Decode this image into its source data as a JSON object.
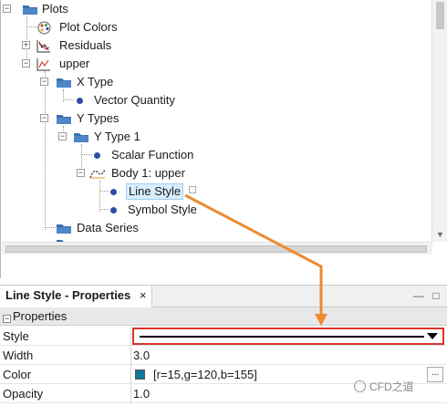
{
  "tree": {
    "items": [
      {
        "label": "Plots"
      },
      {
        "label": "Plot Colors"
      },
      {
        "label": "Residuals"
      },
      {
        "label": "upper"
      },
      {
        "label": "X Type"
      },
      {
        "label": "Vector Quantity"
      },
      {
        "label": "Y Types"
      },
      {
        "label": "Y Type 1"
      },
      {
        "label": "Scalar Function"
      },
      {
        "label": "Body 1: upper"
      },
      {
        "label": "Line Style"
      },
      {
        "label": "Symbol Style"
      },
      {
        "label": "Data Series"
      }
    ]
  },
  "properties_panel": {
    "tab_title": "Line Style - Properties",
    "close_glyph": "×",
    "section": "Properties",
    "rows": [
      {
        "name": "Style",
        "value": ""
      },
      {
        "name": "Width",
        "value": "3.0"
      },
      {
        "name": "Color",
        "value": "[r=15,g=120,b=155]"
      },
      {
        "name": "Opacity",
        "value": "1.0"
      }
    ],
    "color_swatch": "#0f789b",
    "browse_button": "..."
  },
  "annotation": {
    "arrow_color": "#ee8a30",
    "highlight_color": "#d9332e"
  },
  "watermark": "CFD之道"
}
